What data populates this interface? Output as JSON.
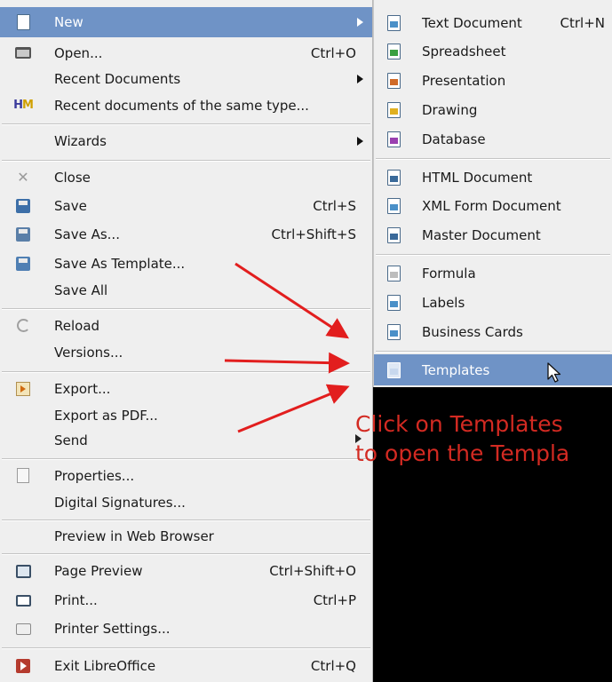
{
  "main_menu": {
    "new": {
      "label": "New"
    },
    "open": {
      "label": "Open...",
      "shortcut": "Ctrl+O"
    },
    "recent_documents": {
      "label": "Recent Documents"
    },
    "recent_same_type": {
      "label": "Recent documents of the same type..."
    },
    "wizards": {
      "label": "Wizards"
    },
    "close": {
      "label": "Close"
    },
    "save": {
      "label": "Save",
      "shortcut": "Ctrl+S"
    },
    "save_as": {
      "label": "Save As...",
      "shortcut": "Ctrl+Shift+S"
    },
    "save_as_template": {
      "label": "Save As Template..."
    },
    "save_all": {
      "label": "Save All"
    },
    "reload": {
      "label": "Reload"
    },
    "versions": {
      "label": "Versions..."
    },
    "export": {
      "label": "Export..."
    },
    "export_pdf": {
      "label": "Export as PDF..."
    },
    "send": {
      "label": "Send"
    },
    "properties": {
      "label": "Properties..."
    },
    "digital_signatures": {
      "label": "Digital Signatures..."
    },
    "preview_browser": {
      "label": "Preview in Web Browser"
    },
    "page_preview": {
      "label": "Page Preview",
      "shortcut": "Ctrl+Shift+O"
    },
    "print": {
      "label": "Print...",
      "shortcut": "Ctrl+P"
    },
    "printer_settings": {
      "label": "Printer Settings..."
    },
    "exit": {
      "label": "Exit LibreOffice",
      "shortcut": "Ctrl+Q"
    }
  },
  "new_submenu": {
    "text_document": {
      "label": "Text Document",
      "shortcut": "Ctrl+N"
    },
    "spreadsheet": {
      "label": "Spreadsheet"
    },
    "presentation": {
      "label": "Presentation"
    },
    "drawing": {
      "label": "Drawing"
    },
    "database": {
      "label": "Database"
    },
    "html_document": {
      "label": "HTML Document"
    },
    "xml_form_document": {
      "label": "XML Form Document"
    },
    "master_document": {
      "label": "Master Document"
    },
    "formula": {
      "label": "Formula"
    },
    "labels": {
      "label": "Labels"
    },
    "business_cards": {
      "label": "Business Cards"
    },
    "templates": {
      "label": "Templates"
    }
  },
  "annotation": {
    "line1": "Click on Templates",
    "line2": "to open the Templa"
  },
  "colors": {
    "highlight": "#6f93c6",
    "annotation_red": "#d32a22"
  }
}
